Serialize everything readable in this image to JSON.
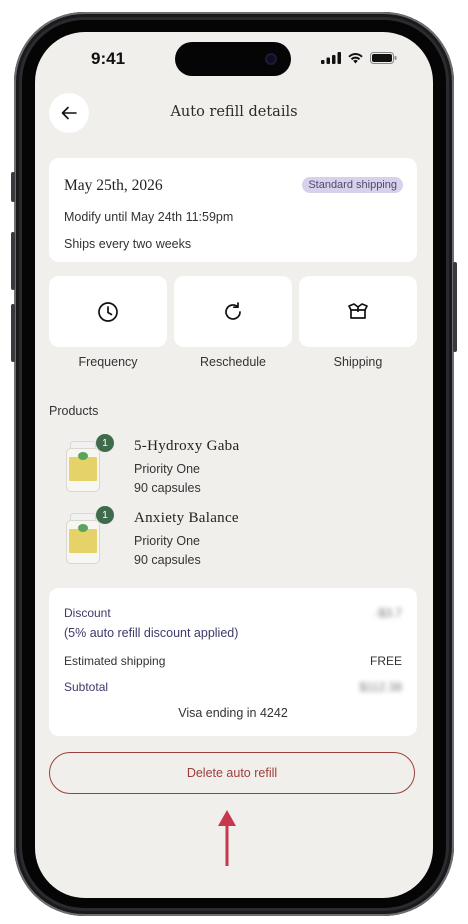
{
  "status_bar": {
    "time": "9:41"
  },
  "header": {
    "title": "Auto refill details"
  },
  "refill": {
    "date": "May 25th, 2026",
    "badge": "Standard shipping",
    "modify_until": "Modify until May 24th 11:59pm",
    "frequency_text": "Ships every two weeks"
  },
  "actions": [
    {
      "label": "Frequency",
      "icon": "clock-icon"
    },
    {
      "label": "Reschedule",
      "icon": "refresh-icon"
    },
    {
      "label": "Shipping",
      "icon": "box-icon"
    }
  ],
  "products_label": "Products",
  "products": [
    {
      "name": "5-Hydroxy Gaba",
      "brand": "Priority One",
      "quantity_text": "90 capsules",
      "count": "1"
    },
    {
      "name": "Anxiety Balance",
      "brand": "Priority One",
      "quantity_text": "90 capsules",
      "count": "1"
    }
  ],
  "summary": {
    "discount_label": "Discount",
    "discount_note": "(5% auto refill discount applied)",
    "discount_value": "-$3.7",
    "shipping_label": "Estimated shipping",
    "shipping_value": "FREE",
    "subtotal_label": "Subtotal",
    "subtotal_value": "$112.38",
    "payment_text": "Visa ending in 4242"
  },
  "delete_label": "Delete auto refill",
  "colors": {
    "background": "#f1efec",
    "badge_bg": "#d8d1ec",
    "delete_accent": "#9c3f3b",
    "annotation_arrow": "#c8384c",
    "quantity_badge": "#3f6b4d"
  }
}
